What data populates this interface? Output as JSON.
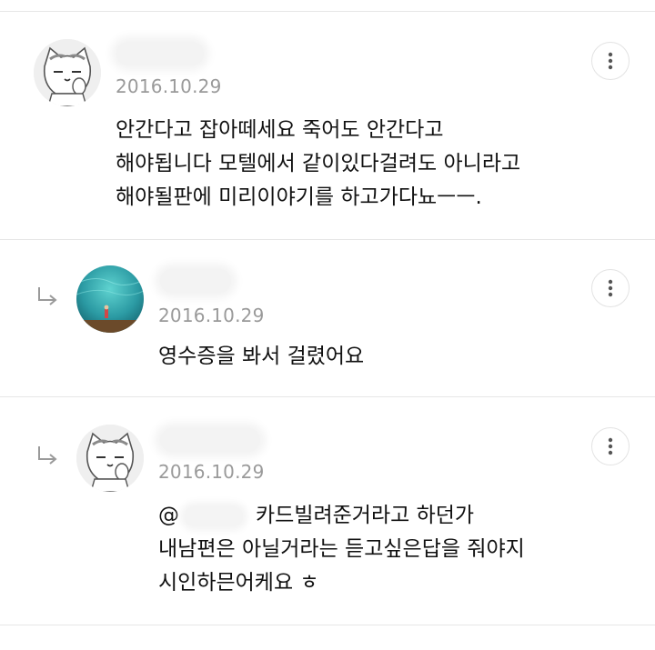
{
  "comments": [
    {
      "date": "2016.10.29",
      "lines": [
        "안간다고 잡아떼세요 죽어도 안간다고",
        "해야됩니다 모텔에서 같이있다걸려도 아니라고",
        "해야될판에 미리이야기를 하고가다뇨ㅡㅡ."
      ],
      "avatar": "cat-avatar",
      "more_icon": "more-vertical-icon"
    },
    {
      "date": "2016.10.29",
      "lines": [
        "영수증을 봐서 걸렸어요"
      ],
      "avatar": "underwater-avatar",
      "reply_icon": "reply-arrow-icon",
      "more_icon": "more-vertical-icon"
    },
    {
      "date": "2016.10.29",
      "mention_prefix": "@",
      "lines": [
        "카드빌려준거라고 하던가",
        "내남편은 아닐거라는 듣고싶은답을 줘야지",
        "시인하믄어케요 ㅎ"
      ],
      "avatar": "cat-avatar",
      "reply_icon": "reply-arrow-icon",
      "more_icon": "more-vertical-icon"
    }
  ],
  "colors": {
    "date": "#9a9a9a",
    "divider": "#e6e6e6",
    "text": "#111111"
  }
}
